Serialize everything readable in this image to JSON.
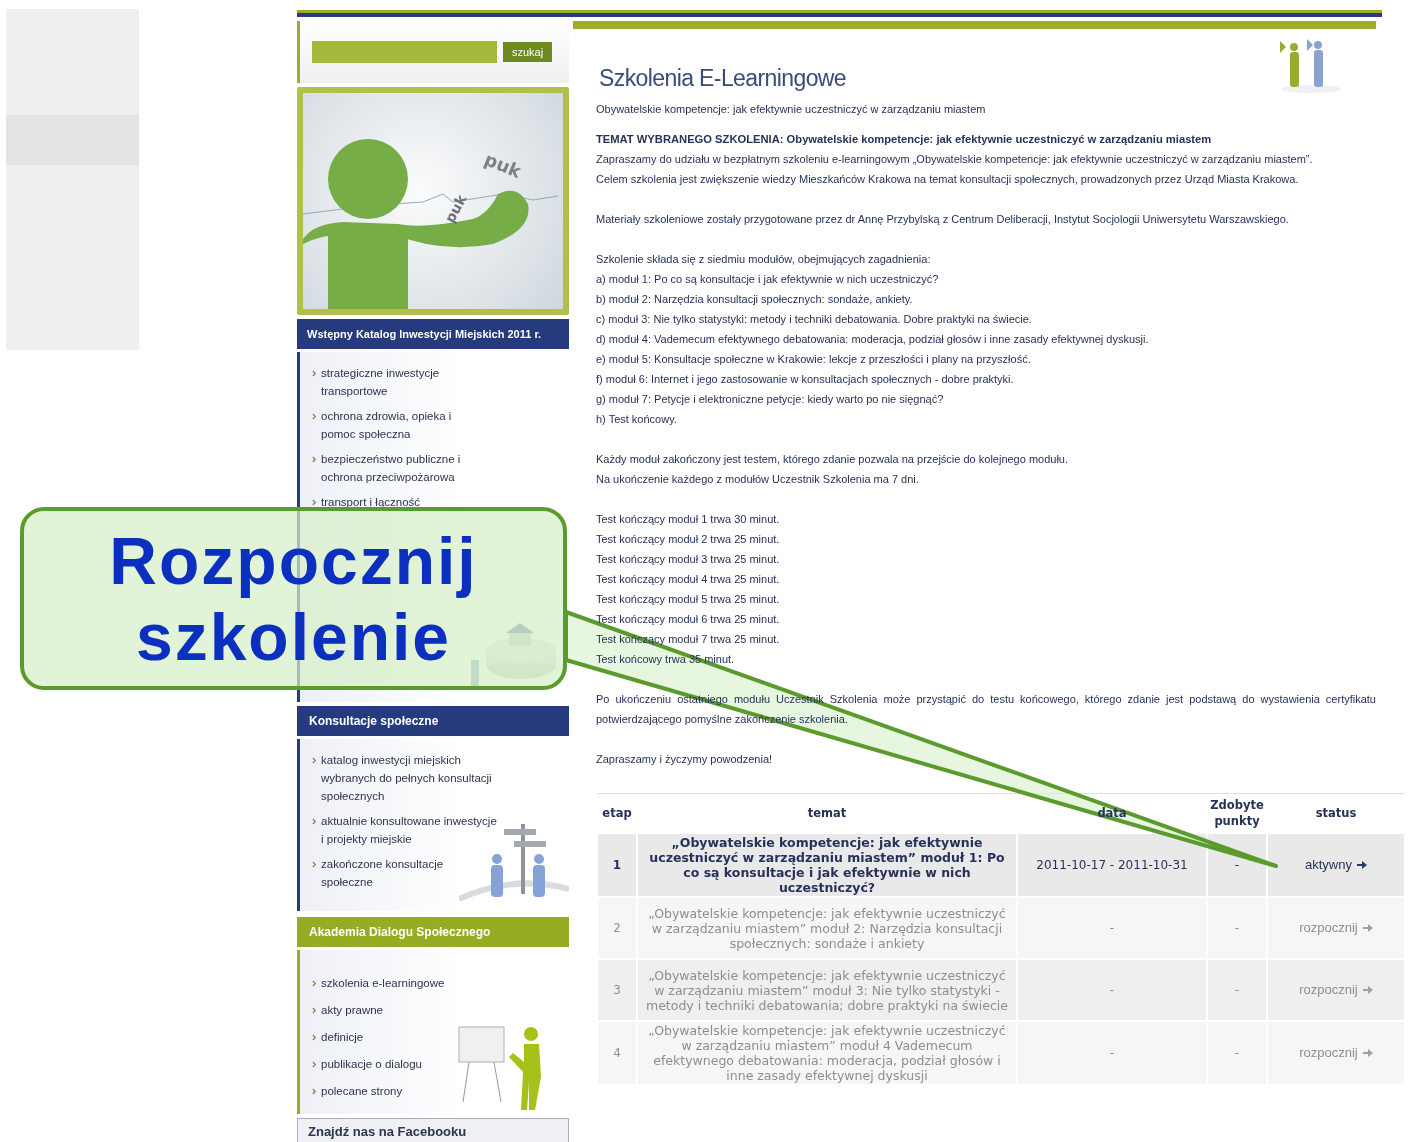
{
  "search": {
    "button": "szukaj"
  },
  "banner": {
    "labels": [
      "puk",
      "puk"
    ]
  },
  "sidebar_sections": [
    {
      "title": "Wstępny Katalog Inwestycji Miejskich 2011 r.",
      "kind": "navy",
      "items": [
        "strategiczne inwestycje transportowe",
        "ochrona zdrowia, opieka i pomoc społeczna",
        "bezpieczeństwo publiczne i ochrona przeciwpożarowa",
        "transport i łączność"
      ]
    },
    {
      "title": "Konsultacje społeczne",
      "kind": "navy",
      "items": [
        "katalog inwestycji miejskich wybranych do pełnych konsultacji społecznych",
        "aktualnie konsultowane inwestycje i projekty miejskie",
        "zakończone konsultacje społeczne"
      ]
    },
    {
      "title": "Akademia Dialogu Społecznego",
      "kind": "green",
      "items": [
        "szkolenia e-learningowe",
        "akty prawne",
        "definicje",
        "publikacje o dialogu",
        "polecane strony"
      ]
    }
  ],
  "facebook_box": {
    "title": "Znajdź nas na Facebooku"
  },
  "main": {
    "title": "Szkolenia E-Learningowe",
    "subtitle": "Obywatelskie kompetencje: jak efektywnie uczestniczyć w zarządzaniu miastem",
    "topic": "TEMAT WYBRANEGO SZKOLENIA: Obywatelskie kompetencje: jak efektywnie uczestniczyć w zarządzaniu miastem",
    "blocks": [
      [
        "Zapraszamy do udziału w bezpłatnym szkoleniu e-learningowym „Obywatelskie kompetencje: jak efektywnie uczestniczyć w zarządzaniu miastem”.",
        "Celem szkolenia jest zwiększenie wiedzy Mieszkańców Krakowa na temat konsultacji społecznych, prowadzonych przez Urząd Miasta Krakowa."
      ],
      [
        "Materiały szkoleniowe zostały przygotowane przez dr Annę Przybylską z Centrum Deliberacji, Instytut Socjologii Uniwersytetu Warszawskiego."
      ],
      [
        "Szkolenie składa się z siedmiu modułów, obejmujących zagadnienia:",
        "a) moduł 1: Po co są konsultacje i jak efektywnie w nich uczestniczyć?",
        "b) moduł 2: Narzędzia konsultacji społecznych: sondaże, ankiety.",
        "c) moduł 3: Nie tylko statystyki: metody i techniki debatowania. Dobre praktyki na świecie.",
        "d) moduł 4: Vademecum efektywnego debatowania: moderacja, podział głosów i inne zasady efektywnej dyskusji.",
        "e) moduł 5: Konsultacje społeczne w Krakowie: lekcje z przeszłości i plany na przyszłość.",
        "f) moduł 6: Internet i jego zastosowanie w konsultacjach społecznych - dobre praktyki.",
        "g) moduł 7: Petycje i elektroniczne petycje: kiedy warto po nie sięgnąć?",
        "h) Test końcowy."
      ],
      [
        "Każdy moduł zakończony jest testem, którego zdanie pozwala na przejście do kolejnego modułu.",
        "Na ukończenie każdego z modułów Uczestnik Szkolenia ma 7 dni."
      ],
      [
        "Test kończący moduł 1 trwa 30 minut.",
        "Test kończący moduł 2 trwa 25 minut.",
        "Test kończący moduł 3 trwa 25 minut.",
        "Test kończący moduł 4 trwa 25 minut.",
        "Test kończący moduł 5 trwa 25 minut.",
        "Test kończący moduł 6 trwa 25 minut.",
        "Test kończący moduł 7 trwa 25 minut.",
        "Test końcowy trwa 35 minut."
      ],
      [
        "Po ukończeniu ostatniego modułu Uczestnik Szkolenia może przystąpić do testu końcowego, którego zdanie jest podstawą do wystawienia certyfikatu potwierdzającego pomyślne zakończenie szkolenia."
      ],
      [
        "Zapraszamy i życzymy powodzenia!"
      ]
    ]
  },
  "table": {
    "columns": [
      "etap",
      "temat",
      "data",
      "Zdobyte punkty",
      "status"
    ],
    "rows": [
      {
        "stage": "1",
        "topic": "„Obywatelskie kompetencje: jak efektywnie uczestniczyć w zarządzaniu miastem” moduł 1: Po co są konsultacje i jak efektywnie w nich uczestniczyć?",
        "date": "2011-10-17 - 2011-10-31",
        "points": "-",
        "status": "aktywny",
        "active": true
      },
      {
        "stage": "2",
        "topic": "„Obywatelskie kompetencje: jak efektywnie uczestniczyć w zarządzaniu miastem” moduł 2: Narzędzia konsultacji społecznych: sondaże i ankiety",
        "date": "-",
        "points": "-",
        "status": "rozpocznij",
        "active": false
      },
      {
        "stage": "3",
        "topic": "„Obywatelskie kompetencje: jak efektywnie uczestniczyć w zarządzaniu miastem” moduł 3: Nie tylko statystyki - metody i techniki debatowania; dobre praktyki na świecie",
        "date": "-",
        "points": "-",
        "status": "rozpocznij",
        "active": false
      },
      {
        "stage": "4",
        "topic": "„Obywatelskie kompetencje: jak efektywnie uczestniczyć w zarządzaniu miastem” moduł 4 Vademecum efektywnego debatowania: moderacja, podział głosów i inne zasady efektywnej dyskusji",
        "date": "-",
        "points": "-",
        "status": "rozpocznij",
        "active": false
      }
    ]
  },
  "callout": {
    "text": "Rozpocznij szkolenie"
  }
}
